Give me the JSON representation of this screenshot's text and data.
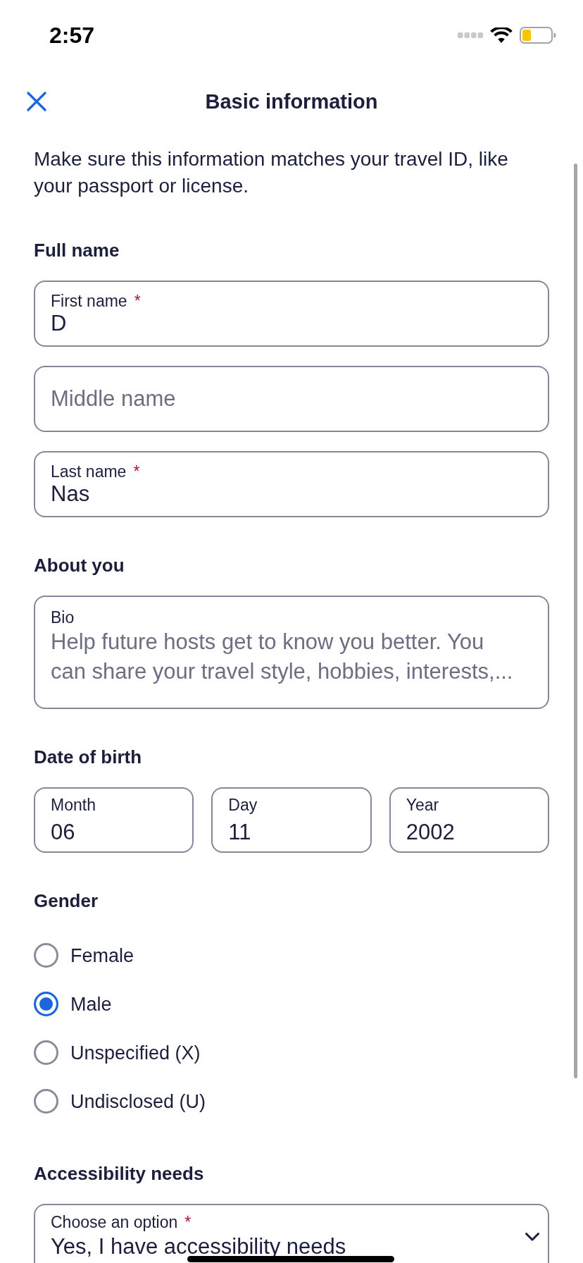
{
  "status_bar": {
    "time": "2:57"
  },
  "header": {
    "title": "Basic information"
  },
  "intro": "Make sure this information matches your travel ID, like your passport or license.",
  "full_name": {
    "heading": "Full name",
    "fields": [
      {
        "label": "First name",
        "required_mark": "*",
        "value": "D"
      },
      {
        "placeholder": "Middle name"
      },
      {
        "label": "Last name",
        "required_mark": "*",
        "value": "Nas"
      }
    ]
  },
  "about_you": {
    "heading": "About you",
    "bio": {
      "label": "Bio",
      "placeholder": "Help future hosts get to know you better. You can share your travel style, hobbies, interests,..."
    }
  },
  "date_of_birth": {
    "heading": "Date of birth",
    "fields": [
      {
        "label": "Month",
        "value": "06"
      },
      {
        "label": "Day",
        "value": "11"
      },
      {
        "label": "Year",
        "value": "2002"
      }
    ]
  },
  "gender": {
    "heading": "Gender",
    "options": [
      {
        "label": "Female",
        "selected": false
      },
      {
        "label": "Male",
        "selected": true
      },
      {
        "label": "Unspecified (X)",
        "selected": false
      },
      {
        "label": "Undisclosed (U)",
        "selected": false
      }
    ]
  },
  "accessibility": {
    "heading": "Accessibility needs",
    "select": {
      "label": "Choose an option",
      "required_mark": "*",
      "value": "Yes, I have accessibility needs"
    }
  }
}
